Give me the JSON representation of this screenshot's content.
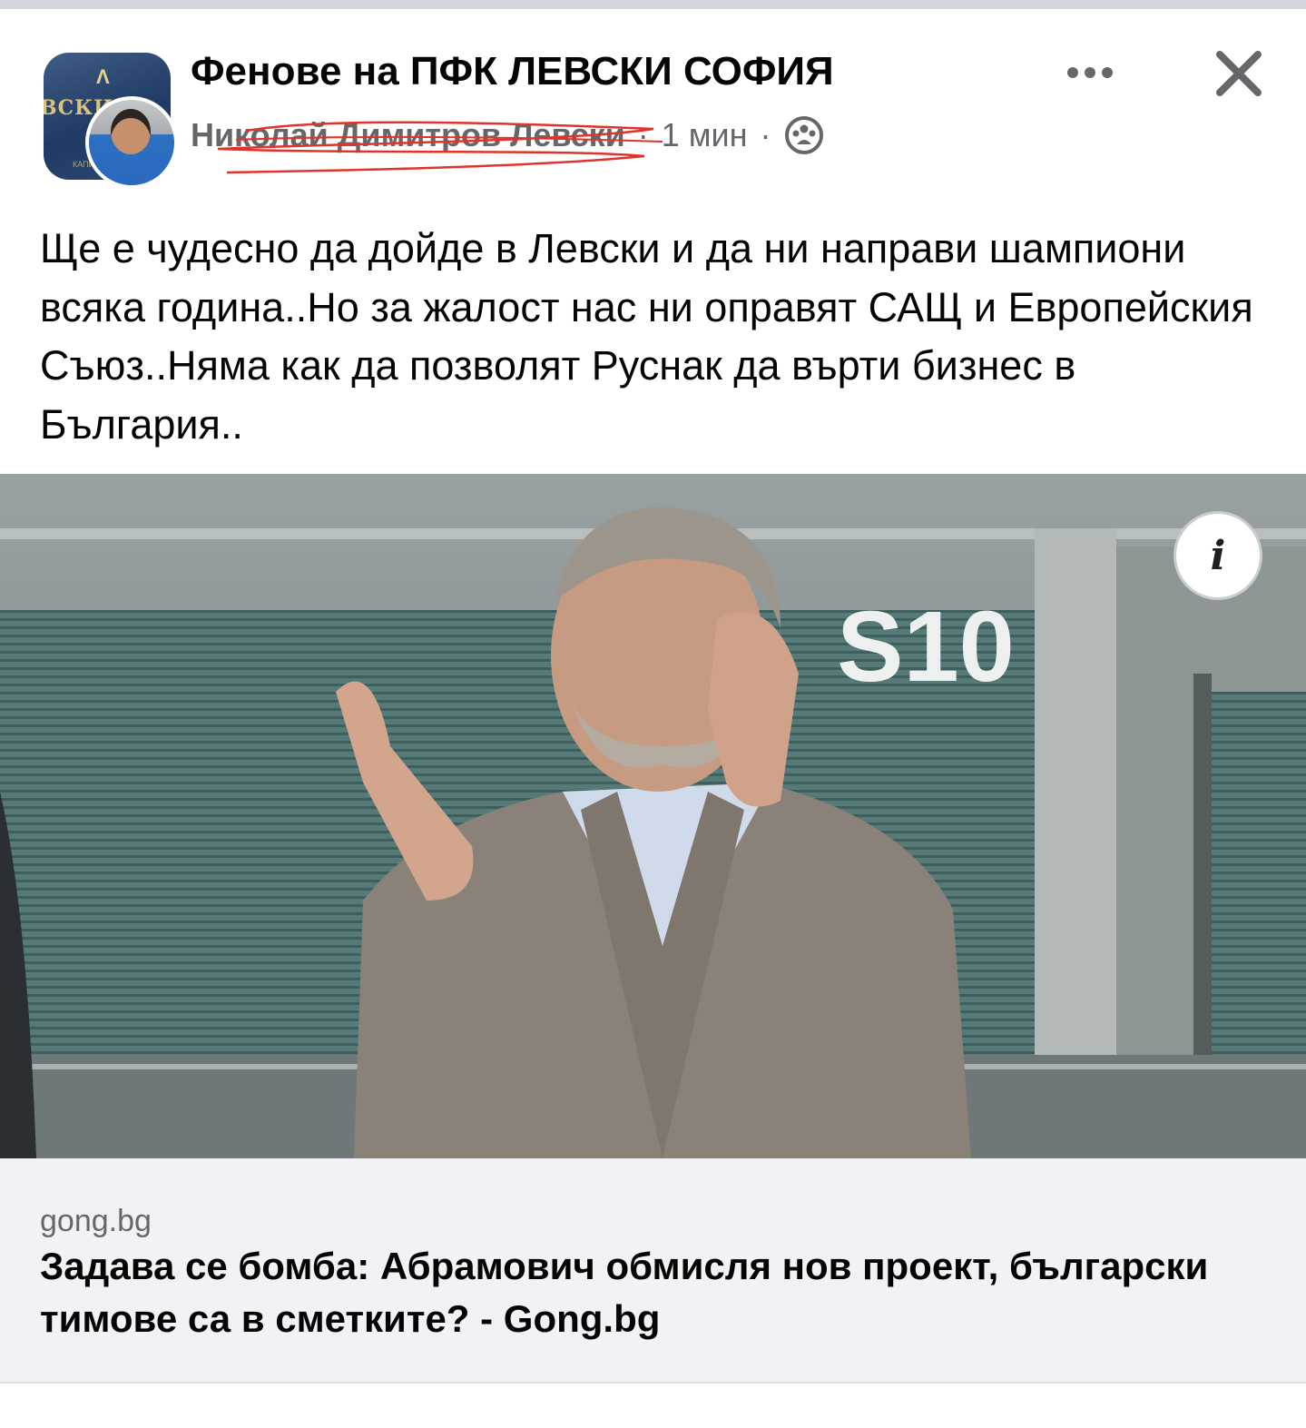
{
  "header": {
    "group_name": "Фенове на ПФК ЛЕВСКИ СОФИЯ",
    "author_name": "Николай Димитров Левски",
    "separator": "·",
    "timestamp": "1 мин",
    "group_avatar_text": "ВСКИ",
    "group_avatar_crest": "Λ",
    "group_avatar_small_text": "КАПИ",
    "more_icon": "more-dots-icon",
    "close_icon": "close-icon",
    "audience_icon": "group-members-icon"
  },
  "post": {
    "text": "Ще е чудесно да дойде в Левски и да ни направи шампиони всяка година..Но за жалост нас ни оправят САЩ и Европейския Съюз..Няма как да позволят Руснак да върти бизнес в България.."
  },
  "image": {
    "sign_text": "S10",
    "info_label": "i"
  },
  "link": {
    "domain": "gong.bg",
    "title": "Задава се бомба: Абрамович обмисля нов проект, български тимове са в сметките? - Gong.bg"
  },
  "colors": {
    "text_primary": "#050505",
    "text_secondary": "#65676b",
    "link_background": "#f0f2f5",
    "scribble_red": "#e0332b"
  }
}
